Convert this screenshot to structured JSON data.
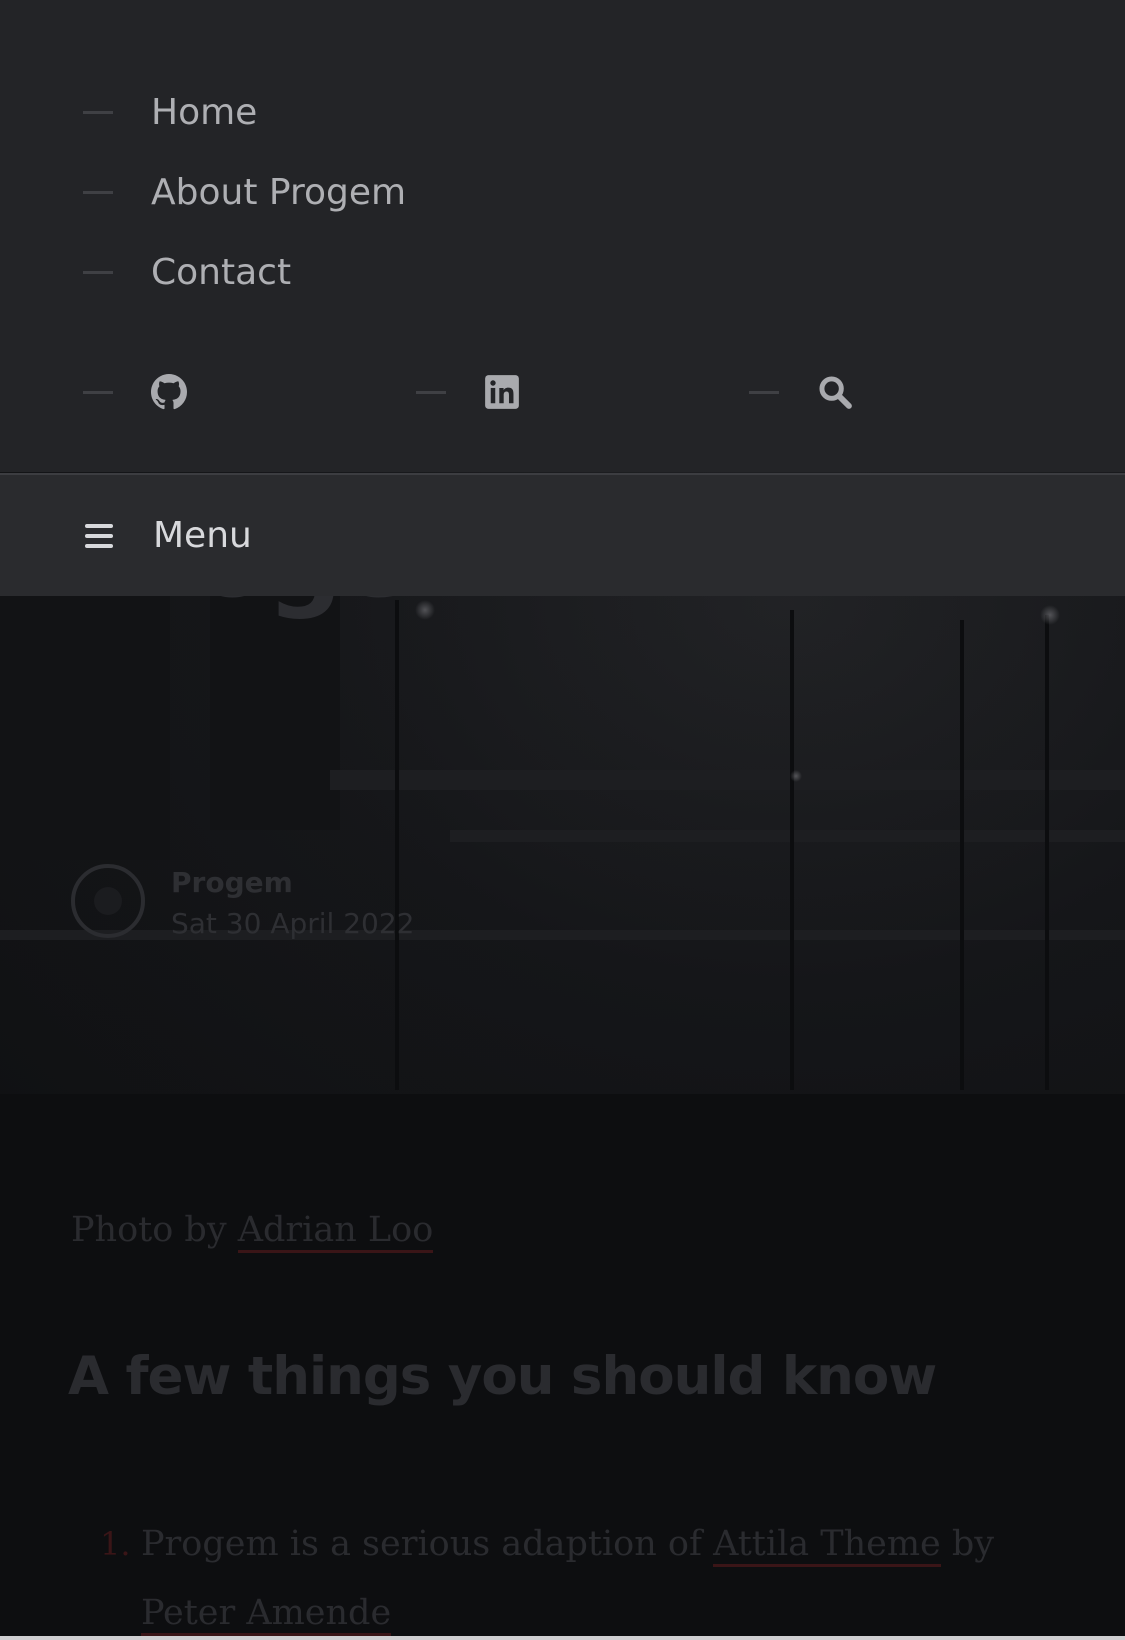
{
  "nav": {
    "items": [
      {
        "label": "Home"
      },
      {
        "label": "About Progem"
      },
      {
        "label": "Contact"
      }
    ],
    "social": [
      {
        "icon": "github-icon"
      },
      {
        "icon": "linkedin-icon"
      },
      {
        "icon": "search-icon"
      }
    ]
  },
  "menu_bar": {
    "label": "Menu",
    "icon": "hamburger-menu-icon"
  },
  "hero": {
    "title_visible": "Progem",
    "author": "Progem",
    "date": "Sat 30 April 2022"
  },
  "article": {
    "photo_credit_prefix": "Photo by",
    "photo_credit_link": "Adrian Loo",
    "heading": "A few things you should know",
    "list": [
      {
        "marker": "1.",
        "text_before": "Progem is a serious adaption of",
        "link1": "Attila Theme",
        "text_middle": "by",
        "link2": "Peter Amende"
      }
    ]
  },
  "colors": {
    "nav_background": "#232427",
    "menu_bar_background": "#2a2b2e",
    "page_background": "#0d0e10",
    "link_underline": "#3a1517"
  }
}
